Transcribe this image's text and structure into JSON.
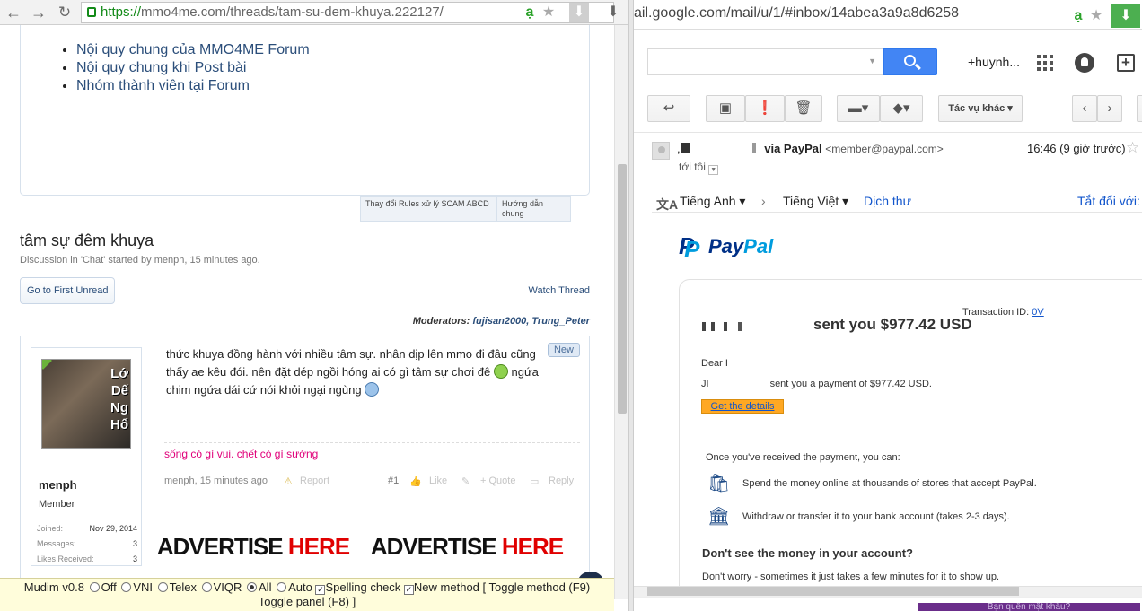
{
  "left_browser": {
    "url_scheme": "https://",
    "url_rest": "mmo4me.com/threads/tam-su-dem-khuya.222127/",
    "translate_glyph": "ạ"
  },
  "rules_links": [
    "Nội quy chung của MMO4ME Forum",
    "Nội quy chung khi Post bài",
    "Nhóm thành viên tại Forum"
  ],
  "sub_tabs": {
    "tab1": "Thay đổi Rules xử lý SCAM ABCD",
    "tab2": "Hướng dẫn chung"
  },
  "thread": {
    "title": "tâm sự đêm khuya",
    "meta": "Discussion in 'Chat' started by menph, 15 minutes ago.",
    "go_first_unread": "Go to First Unread",
    "watch_thread": "Watch Thread",
    "moderators_label": "Moderators:",
    "moderators": "fujisan2000, Trung_Peter"
  },
  "post": {
    "avatar_text": "Lớ\nDế\nNg\nHổ",
    "username": "menph",
    "user_title": "Member",
    "joined_label": "Joined:",
    "joined_value": "Nov 29, 2014",
    "messages_label": "Messages:",
    "messages_value": "3",
    "likes_label": "Likes Received:",
    "likes_value": "3",
    "text_part1": "thức khuya đồng hành với nhiều tâm sự. nhân dịp lên mmo đi đâu cũng thấy ae kêu đói. nên đặt dép ngồi hóng ai có gì tâm sự chơi đê",
    "text_part2": "ngứa chim ngứa dái cứ nói khỏi ngại ngùng",
    "new_badge": "New",
    "signature": "sống có gì vui. chết có gì sướng",
    "footer_author": "menph, 15 minutes ago",
    "report": "Report",
    "post_number": "#1",
    "like": "Like",
    "quote": "+ Quote",
    "reply": "Reply",
    "ad_word1": "ADVERTISE",
    "ad_word2": "HERE"
  },
  "mudim": {
    "name": "Mudim v0.8",
    "off": "Off",
    "vni": "VNI",
    "telex": "Telex",
    "viqr": "VIQR",
    "all": "All",
    "auto": "Auto",
    "spelling": "Spelling check",
    "new_method": "New method [",
    "toggle_method": "Toggle method (F9)",
    "toggle_panel": "Toggle panel (F8) ]"
  },
  "right_browser": {
    "url": "ail.google.com/mail/u/1/#inbox/14abea3a9a8d6258",
    "translate_glyph": "ạ"
  },
  "gmail": {
    "user": "+huynh...",
    "more_actions": "Tác vụ khác",
    "sender_prefix": ",",
    "sender_via": "via PayPal",
    "sender_email": "<member@paypal.com>",
    "time": "16:46 (9 giờ trước)",
    "to_me": "tới tôi",
    "translate_from": "Tiếng Anh",
    "translate_to": "Tiếng Việt",
    "translate_link": "Dịch thư",
    "translate_off": "Tắt đổi với: "
  },
  "paypal": {
    "logo_p1": "Pay",
    "logo_p2": "Pal",
    "transaction_label": "Transaction ID:",
    "transaction_id": "0V",
    "sent_you": "sent you $977.42 USD",
    "dear": "Dear I",
    "sent_payment_prefix": "JI",
    "sent_payment": "sent you a payment of $977.42 USD.",
    "details_btn": "Get the details",
    "once": "Once you've received the payment, you can:",
    "feature1": "Spend the money online at thousands of stores that accept PayPal.",
    "feature2": "Withdraw or transfer it to your bank account (takes 2-3 days).",
    "dont_see": "Don't see the money in your account?",
    "dont_worry": "Don't worry - sometimes it just takes a few minutes for it to show up.",
    "forgot": "Bạn quên mật khẩu?"
  }
}
